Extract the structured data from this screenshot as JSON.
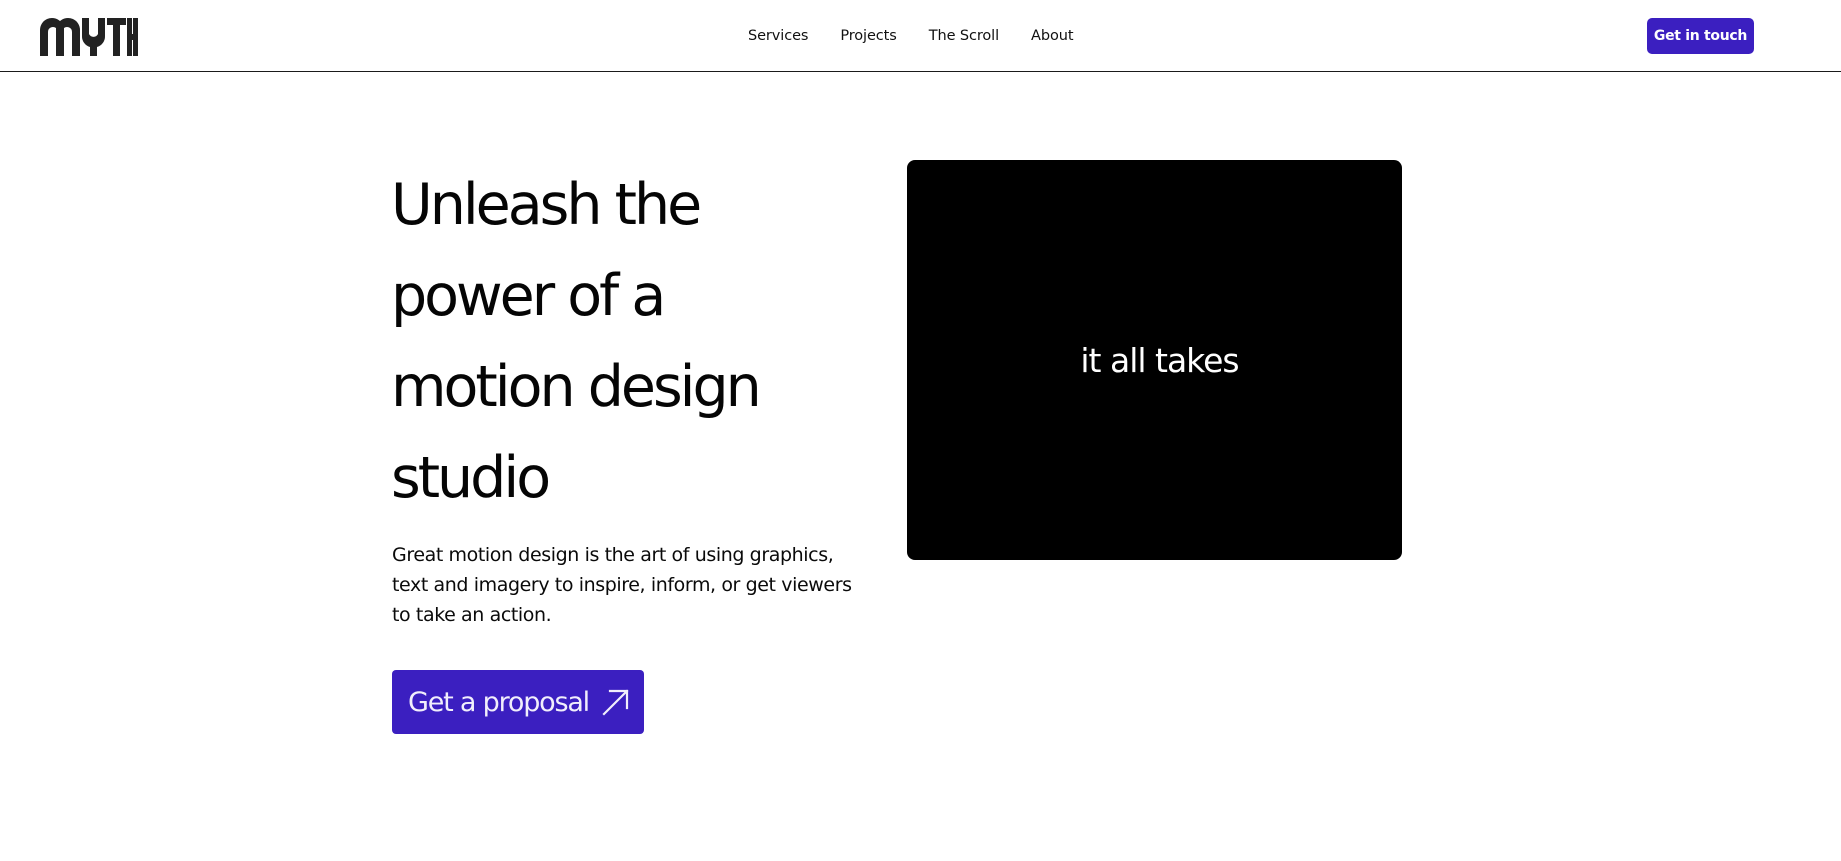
{
  "header": {
    "logo_text": "MYTH",
    "nav": [
      {
        "label": "Services"
      },
      {
        "label": "Projects"
      },
      {
        "label": "The Scroll"
      },
      {
        "label": "About"
      }
    ],
    "cta_label": "Get in touch"
  },
  "hero": {
    "title_lines": [
      "Unleash the",
      "power of a",
      "motion design",
      "studio"
    ],
    "description": "Great motion design is the art of using graphics, text and imagery to inspire, inform, or get viewers to take an action.",
    "cta_label": "Get a proposal",
    "cta_icon": "arrow-up-right-icon"
  },
  "video": {
    "caption": "it all takes"
  },
  "colors": {
    "accent": "#3b1fc0",
    "text": "#000000",
    "background": "#ffffff",
    "video_bg": "#000000"
  }
}
